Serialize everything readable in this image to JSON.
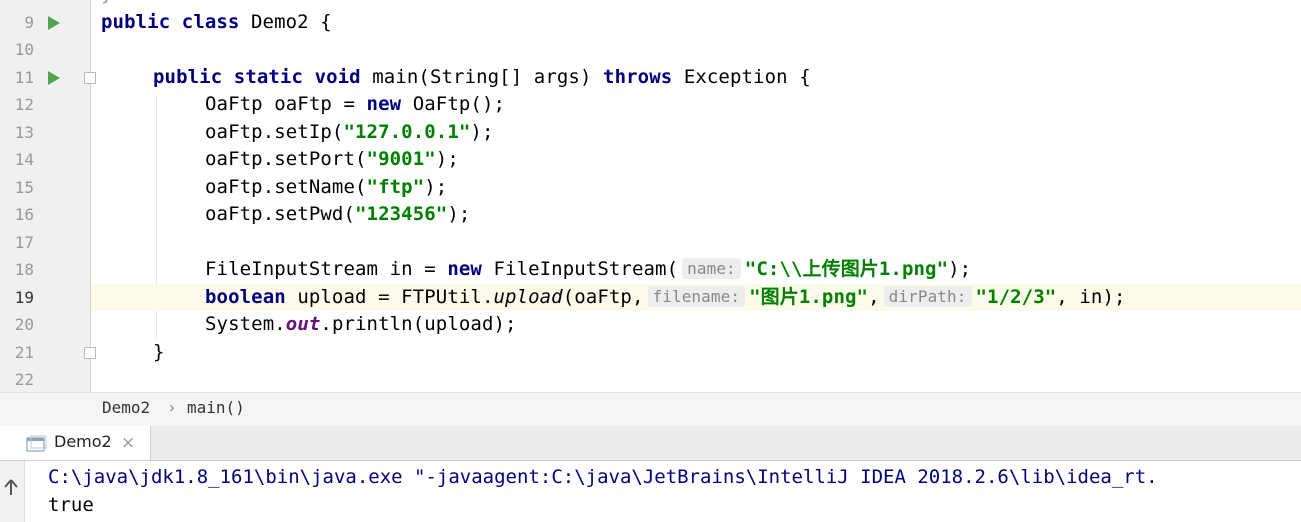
{
  "editor": {
    "lines": [
      {
        "num": "9",
        "text": "public class Demo2 {"
      },
      {
        "num": "10",
        "text": ""
      },
      {
        "num": "11",
        "text": "    public static void main(String[] args) throws Exception {"
      },
      {
        "num": "12",
        "text": "        OaFtp oaFtp = new OaFtp();"
      },
      {
        "num": "13",
        "text": "        oaFtp.setIp(\"127.0.0.1\");"
      },
      {
        "num": "14",
        "text": "        oaFtp.setPort(\"9001\");"
      },
      {
        "num": "15",
        "text": "        oaFtp.setName(\"ftp\");"
      },
      {
        "num": "16",
        "text": "        oaFtp.setPwd(\"123456\");"
      },
      {
        "num": "17",
        "text": ""
      },
      {
        "num": "18",
        "text": "        FileInputStream in = new FileInputStream( name: \"C:\\\\上传图片1.png\");"
      },
      {
        "num": "19",
        "text": "        boolean upload = FTPUtil.upload(oaFtp,  filename: \"图片1.png\",  dirPath: \"1/2/3\", in);"
      },
      {
        "num": "20",
        "text": "        System.out.println(upload);"
      },
      {
        "num": "21",
        "text": "    }"
      },
      {
        "num": "22",
        "text": ""
      }
    ],
    "tokens": {
      "public": "public",
      "class": "class",
      "static": "static",
      "void": "void",
      "throws": "throws",
      "new": "new",
      "boolean": "boolean",
      "class_decl": " Demo2 {",
      "main_sig": " main(String[] args) ",
      "exception": " Exception {",
      "l12_a": "OaFtp oaFtp = ",
      "l12_b": " OaFtp();",
      "l13_a": "oaFtp.setIp(",
      "l13_s": "\"127.0.0.1\"",
      "l13_b": ");",
      "l14_a": "oaFtp.setPort(",
      "l14_s": "\"9001\"",
      "l14_b": ");",
      "l15_a": "oaFtp.setName(",
      "l15_s": "\"ftp\"",
      "l15_b": ");",
      "l16_a": "oaFtp.setPwd(",
      "l16_s": "\"123456\"",
      "l16_b": ");",
      "l18_a": "FileInputStream in = ",
      "l18_b": " FileInputStream(",
      "l18_hint": "name:",
      "l18_s": "\"C:\\\\上传图片1.png\"",
      "l18_c": ");",
      "l19_a": " upload = FTPUtil.",
      "l19_m": "upload",
      "l19_b": "(oaFtp,",
      "l19_hint1": "filename:",
      "l19_s1": "\"图片1.png\"",
      "l19_c": ",",
      "l19_hint2": "dirPath:",
      "l19_s2": "\"1/2/3\"",
      "l19_d": ", in);",
      "l20_a": "System.",
      "l20_f": "out",
      "l20_b": ".println(upload);",
      "l21": "}"
    }
  },
  "breadcrumb": {
    "class": "Demo2",
    "separator": "›",
    "method": "main()"
  },
  "run_panel": {
    "tab_label": "Demo2",
    "close": "×"
  },
  "console": {
    "lines": [
      "C:\\java\\jdk1.8_161\\bin\\java.exe \"-javaagent:C:\\java\\JetBrains\\IntelliJ IDEA 2018.2.6\\lib\\idea_rt.",
      "true"
    ]
  }
}
